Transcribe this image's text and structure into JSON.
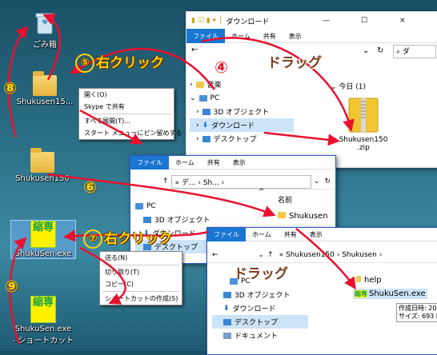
{
  "desktop": {
    "recycle_bin": "ごみ箱",
    "shukusen15_zip": "Shukusen15...",
    "shukusen150_folder": "Shukusen150",
    "shukusen_exe": "ShukuSen.exe",
    "shortcut_line1": "ShukuSen.exe",
    "shortcut_line2": "- ショートカット",
    "app_icon_text": "縮専"
  },
  "context_menu_1": {
    "items": [
      "開く(O)",
      "Skype で共有",
      "すべて展開(T)...",
      "スタート メニューにピン留めする"
    ]
  },
  "context_menu_2": {
    "items": [
      "送る(N)",
      "切り取り(T)",
      "コピー(C)",
      "ショートカットの作成(S)"
    ]
  },
  "download_window": {
    "title": "ダウンロード",
    "min": "—",
    "max": "☐",
    "close": "×",
    "tabs": [
      "ファイル",
      "ホーム",
      "共有",
      "表示"
    ],
    "search_placeholder": "ダ",
    "nav": [
      "音楽",
      "PC",
      "3D オブジェクト",
      "ダウンロード",
      "デスクトップ"
    ],
    "group_header": "今日 (1)",
    "file_name_line1": "Shukusen150",
    "file_name_line2": ".zip"
  },
  "window_2": {
    "tabs": [
      "ファイル",
      "ホーム",
      "共有",
      "表示"
    ],
    "address": "« デ... › Sh... ›",
    "nav": [
      "PC",
      "3D オブジェクト",
      "ダウンロード",
      "デスクトップ"
    ],
    "column_header": "名前",
    "item": "Shukusen"
  },
  "window_3": {
    "tabs": [
      "ファイル",
      "ホーム",
      "共有",
      "表示"
    ],
    "address": "« Shukusen150 › Shukusen ›",
    "nav": [
      "PC",
      "3D オブジェクト",
      "ダウンロード",
      "デスクトップ",
      "ドキュメント"
    ],
    "items": [
      "help",
      "ShukuSen.exe"
    ],
    "tooltip_line1": "作成日時: 20",
    "tooltip_line2": "サイズ: 693 K"
  },
  "annotations": {
    "step4": "④",
    "step5": "⑤",
    "step5_text": "右クリック",
    "step6": "⑥",
    "step7": "⑦",
    "step7_text": "右クリック",
    "step8": "⑧",
    "step9": "⑨",
    "drag1": "ドラッグ",
    "drag2": "ドラッグ"
  },
  "colors": {
    "arrow": "#e8112d",
    "caption": "#ffd400",
    "caption_brown": "#7b3c1a",
    "ribbon_file": "#1976d2"
  }
}
